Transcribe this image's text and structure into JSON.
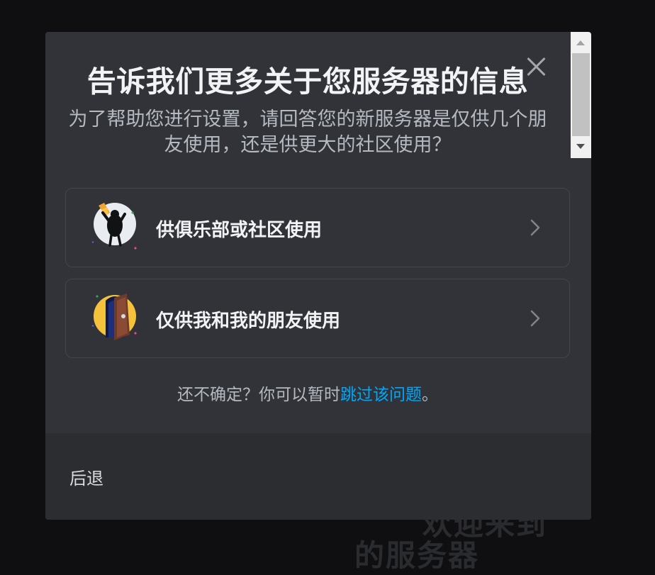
{
  "background": {
    "partial_text_line1": "欢迎来到",
    "partial_text_line2": "的服务器"
  },
  "modal": {
    "title": "告诉我们更多关于您服务器的信息",
    "subtitle": "为了帮助您进行设置，请回答您的新服务器是仅供几个朋友使用，还是供更大的社区使用？",
    "close_icon": "close-icon",
    "options": [
      {
        "label": "供俱乐部或社区使用",
        "icon": "community-illustration-icon",
        "chevron": "chevron-right-icon"
      },
      {
        "label": "仅供我和我的朋友使用",
        "icon": "friends-door-illustration-icon",
        "chevron": "chevron-right-icon"
      }
    ],
    "hint_prefix": "还不确定？你可以暂时",
    "hint_link": "跳过该问题",
    "hint_suffix": "。",
    "back_label": "后退"
  },
  "colors": {
    "backdrop": "#0f0f11",
    "modal_bg": "#313338",
    "footer_bg": "#2b2d31",
    "link": "#00a8fc",
    "title": "#f2f3f5",
    "subtitle": "#b5bac1"
  }
}
